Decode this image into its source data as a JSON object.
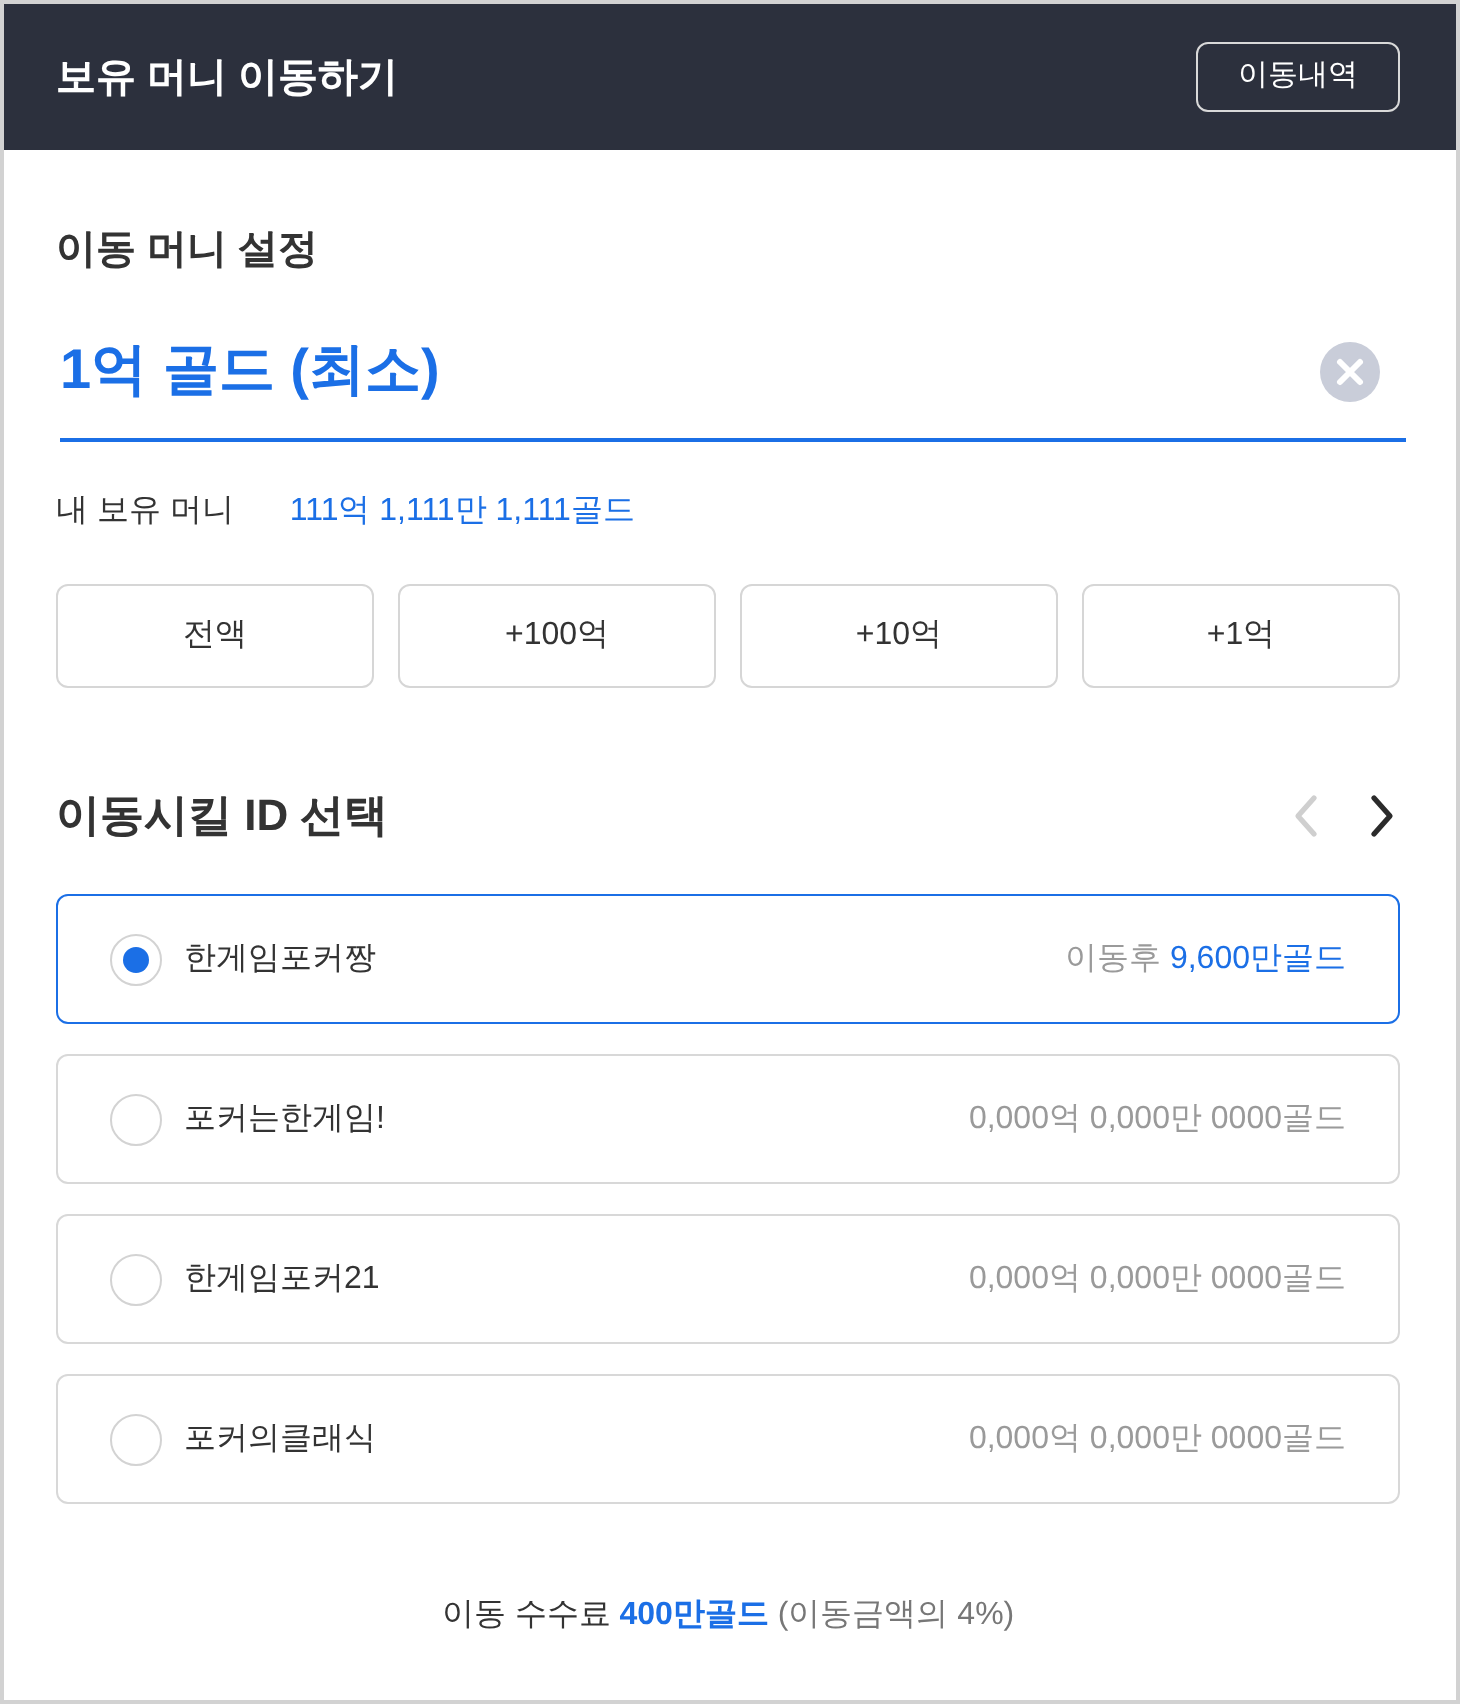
{
  "header": {
    "title": "보유 머니 이동하기",
    "history_button": "이동내역"
  },
  "amount_section": {
    "title": "이동 머니 설정",
    "amount_field": {
      "value": "1억 골드 (최소)"
    },
    "balance": {
      "label": "내 보유 머니",
      "value": "111억 1,111만 1,111골드"
    },
    "quick_buttons": [
      "전액",
      "+100억",
      "+10억",
      "+1억"
    ]
  },
  "id_section": {
    "title": "이동시킬 ID 선택",
    "pager": [
      {
        "kind": "prev",
        "disabled": true
      },
      {
        "kind": "next",
        "disabled": false
      }
    ],
    "ids": [
      {
        "name": "한게임포커짱",
        "selected": true,
        "balance_label": "이동후",
        "balance": "9,600만골드"
      },
      {
        "name": "포커는한게임!",
        "selected": false,
        "balance": "0,000억 0,000만 0000골드"
      },
      {
        "name": "한게임포커21",
        "selected": false,
        "balance": "0,000억 0,000만 0000골드"
      },
      {
        "name": "포커의클래식",
        "selected": false,
        "balance": "0,000억 0,000만 0000골드"
      }
    ]
  },
  "fee": {
    "label": "이동 수수료",
    "amount": "400만골드",
    "note": "(이동금액의 4%)"
  }
}
